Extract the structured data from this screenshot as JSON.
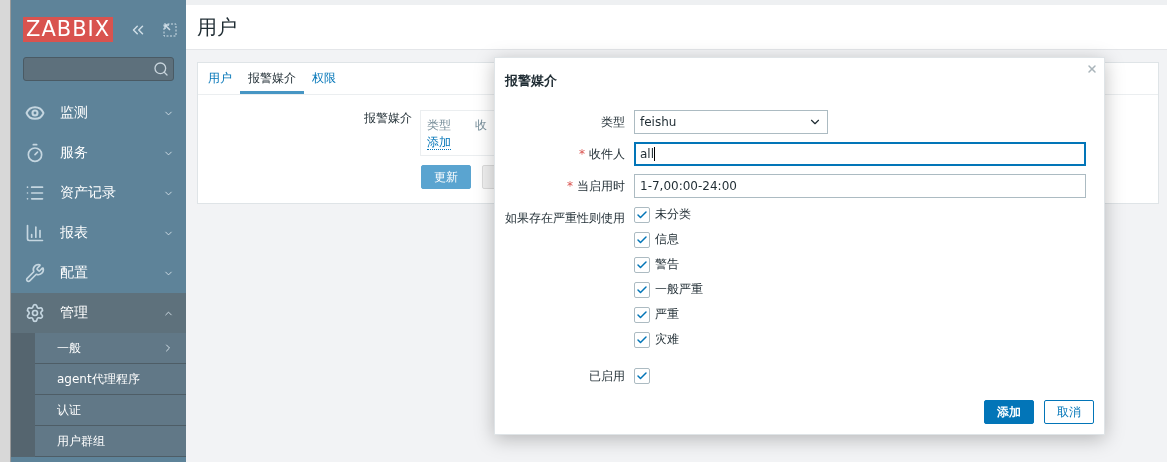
{
  "logo": "ZABBIX",
  "sidebar": {
    "items": [
      {
        "label": "监测",
        "kind": "eye",
        "expanded": false,
        "selected": false
      },
      {
        "label": "服务",
        "kind": "timer",
        "expanded": false,
        "selected": false
      },
      {
        "label": "资产记录",
        "kind": "list",
        "expanded": false,
        "selected": false
      },
      {
        "label": "报表",
        "kind": "chart",
        "expanded": false,
        "selected": false
      },
      {
        "label": "配置",
        "kind": "wrench",
        "expanded": false,
        "selected": false
      },
      {
        "label": "管理",
        "kind": "gear",
        "expanded": true,
        "selected": true,
        "children": [
          {
            "label": "一般",
            "has_submenu": true
          },
          {
            "label": "agent代理程序",
            "has_submenu": false
          },
          {
            "label": "认证",
            "has_submenu": false
          },
          {
            "label": "用户群组",
            "has_submenu": false
          }
        ]
      }
    ]
  },
  "page": {
    "title": "用户",
    "tabs": [
      {
        "label": "用户",
        "selected": false
      },
      {
        "label": "报警媒介",
        "selected": true
      },
      {
        "label": "权限",
        "selected": false
      }
    ],
    "media_label": "报警媒介",
    "media_columns": [
      "类型",
      "收"
    ],
    "add_link": "添加",
    "buttons": [
      {
        "label": "更新",
        "kind": "primary"
      },
      {
        "kind": "disabled"
      }
    ]
  },
  "dialog": {
    "title": "报警媒介",
    "fields": [
      {
        "label": "类型",
        "kind": "select",
        "value": "feishu"
      },
      {
        "label": "收件人",
        "kind": "input",
        "value": "all",
        "required_mark": "*",
        "focused": true
      },
      {
        "label": "当启用时",
        "kind": "input",
        "value": "1-7,00:00-24:00",
        "required_mark": "*",
        "focused": false
      }
    ],
    "severity_label": "如果存在严重性则使用",
    "severities": [
      {
        "label": "未分类",
        "checked": true
      },
      {
        "label": "信息",
        "checked": true
      },
      {
        "label": "警告",
        "checked": true
      },
      {
        "label": "一般严重",
        "checked": true
      },
      {
        "label": "严重",
        "checked": true
      },
      {
        "label": "灾难",
        "checked": true
      }
    ],
    "enabled": {
      "label": "已启用",
      "checked": true
    },
    "buttons": [
      {
        "label": "添加",
        "kind": "primary"
      },
      {
        "label": "取消",
        "kind": "secondary"
      }
    ]
  }
}
